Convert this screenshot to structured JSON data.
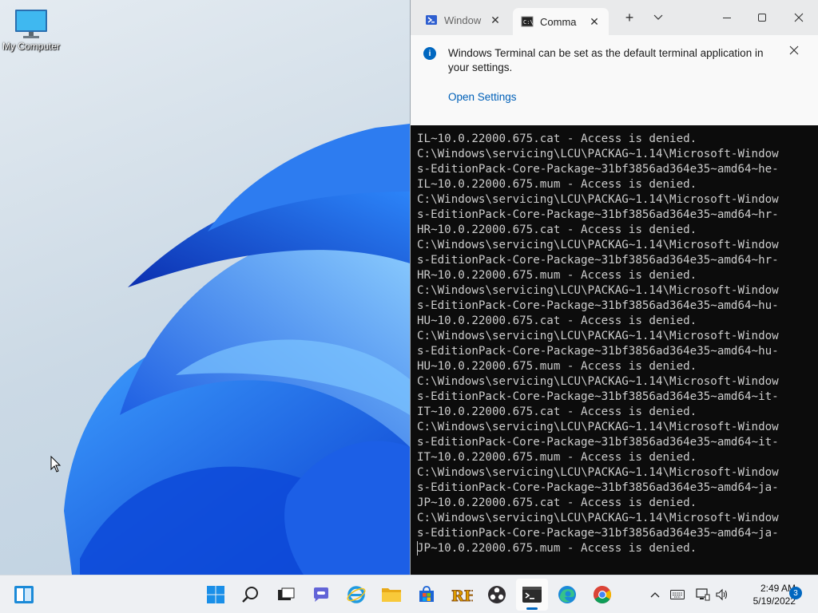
{
  "desktop": {
    "icons": [
      {
        "label": "My Computer",
        "icon": "computer-icon"
      }
    ]
  },
  "terminal": {
    "tabs": [
      {
        "label": "Window",
        "icon": "powershell-icon"
      },
      {
        "label": "Comma",
        "icon": "cmd-icon",
        "active": true
      }
    ],
    "new_tab_symbol": "+",
    "dropdown_symbol": "⌄",
    "infobar": {
      "icon_glyph": "i",
      "message": "Windows Terminal can be set as the default terminal application in your settings.",
      "link": "Open Settings"
    },
    "console_lines": [
      "IL~10.0.22000.675.cat - Access is denied.",
      "C:\\Windows\\servicing\\LCU\\PACKAG~1.14\\Microsoft-Window",
      "s-EditionPack-Core-Package~31bf3856ad364e35~amd64~he-",
      "IL~10.0.22000.675.mum - Access is denied.",
      "C:\\Windows\\servicing\\LCU\\PACKAG~1.14\\Microsoft-Window",
      "s-EditionPack-Core-Package~31bf3856ad364e35~amd64~hr-",
      "HR~10.0.22000.675.cat - Access is denied.",
      "C:\\Windows\\servicing\\LCU\\PACKAG~1.14\\Microsoft-Window",
      "s-EditionPack-Core-Package~31bf3856ad364e35~amd64~hr-",
      "HR~10.0.22000.675.mum - Access is denied.",
      "C:\\Windows\\servicing\\LCU\\PACKAG~1.14\\Microsoft-Window",
      "s-EditionPack-Core-Package~31bf3856ad364e35~amd64~hu-",
      "HU~10.0.22000.675.cat - Access is denied.",
      "C:\\Windows\\servicing\\LCU\\PACKAG~1.14\\Microsoft-Window",
      "s-EditionPack-Core-Package~31bf3856ad364e35~amd64~hu-",
      "HU~10.0.22000.675.mum - Access is denied.",
      "C:\\Windows\\servicing\\LCU\\PACKAG~1.14\\Microsoft-Window",
      "s-EditionPack-Core-Package~31bf3856ad364e35~amd64~it-",
      "IT~10.0.22000.675.cat - Access is denied.",
      "C:\\Windows\\servicing\\LCU\\PACKAG~1.14\\Microsoft-Window",
      "s-EditionPack-Core-Package~31bf3856ad364e35~amd64~it-",
      "IT~10.0.22000.675.mum - Access is denied.",
      "C:\\Windows\\servicing\\LCU\\PACKAG~1.14\\Microsoft-Window",
      "s-EditionPack-Core-Package~31bf3856ad364e35~amd64~ja-",
      "JP~10.0.22000.675.cat - Access is denied.",
      "C:\\Windows\\servicing\\LCU\\PACKAG~1.14\\Microsoft-Window",
      "s-EditionPack-Core-Package~31bf3856ad364e35~amd64~ja-",
      "JP~10.0.22000.675.mum - Access is denied."
    ]
  },
  "taskbar": {
    "apps": [
      {
        "name": "start-button",
        "icon": "windows-logo-icon"
      },
      {
        "name": "search-button",
        "icon": "search-icon"
      },
      {
        "name": "task-view-button",
        "icon": "task-view-icon"
      },
      {
        "name": "teams-chat-button",
        "icon": "chat-icon"
      },
      {
        "name": "internet-explorer-button",
        "icon": "internet-explorer-icon"
      },
      {
        "name": "file-explorer-button",
        "icon": "folder-icon"
      },
      {
        "name": "microsoft-store-button",
        "icon": "store-icon"
      },
      {
        "name": "resource-hacker-button",
        "icon": "resource-hacker-icon"
      },
      {
        "name": "obs-button",
        "icon": "obs-icon"
      },
      {
        "name": "terminal-button",
        "icon": "terminal-icon",
        "active": true
      },
      {
        "name": "edge-button",
        "icon": "edge-icon"
      },
      {
        "name": "chrome-button",
        "icon": "chrome-icon"
      }
    ],
    "widgets_icon": "widgets-icon",
    "tray": {
      "icons": [
        "chevron-up-icon",
        "keyboard-icon",
        "network-icon",
        "volume-icon"
      ],
      "time": "2:49 AM",
      "date": "5/19/2022",
      "notification_count": "3"
    }
  },
  "colors": {
    "accent": "#0067c0",
    "console_bg": "#0c0c0c",
    "console_fg": "#cccccc",
    "wallpaper_blue": "#1a6fe8"
  }
}
